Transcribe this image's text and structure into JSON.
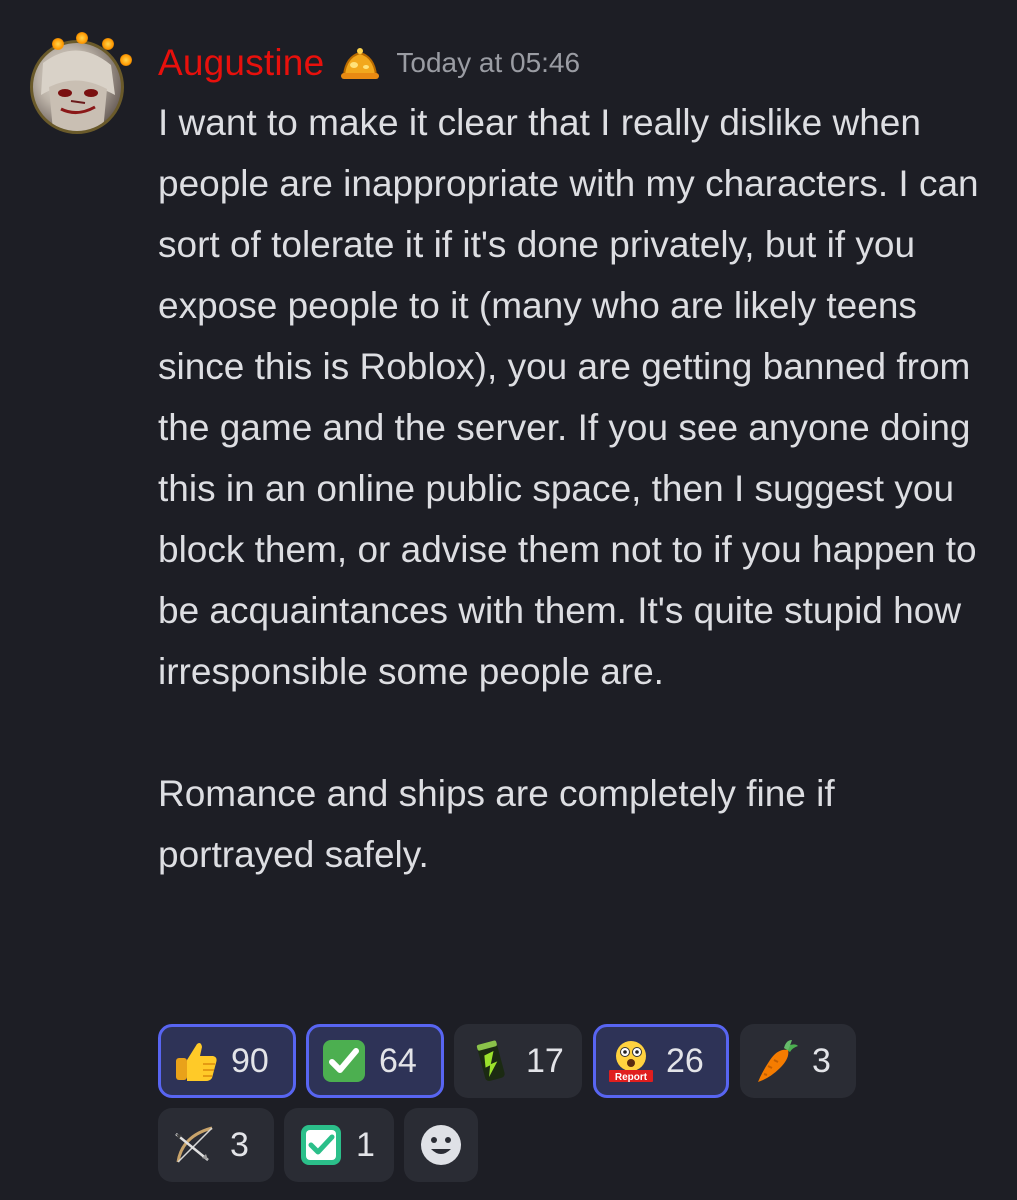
{
  "message": {
    "author": {
      "name": "Augustine",
      "name_color": "#e8100c"
    },
    "timestamp": "Today at 05:46",
    "paragraphs": [
      "I want to make it clear that I really dislike when people are inappropriate with my characters. I can sort of tolerate it if it's done privately, but if you expose people to it (many who are likely teens since this is Roblox), you are getting banned from the game and the server. If you see anyone doing this in an online public space, then I suggest you block them, or advise them not to if you happen to be acquaintances with them. It's quite stupid how irresponsible some people are.",
      "Romance and ships are completely fine if portrayed safely."
    ],
    "reactions": [
      {
        "emoji": "thumbs-up-icon",
        "count": "90",
        "active": true
      },
      {
        "emoji": "check-mark-button-icon",
        "count": "64",
        "active": true
      },
      {
        "emoji": "energy-drink-can-icon",
        "count": "17",
        "active": false
      },
      {
        "emoji": "report-shocked-face-icon",
        "label": "Report",
        "count": "26",
        "active": true
      },
      {
        "emoji": "carrot-icon",
        "count": "3",
        "active": false
      },
      {
        "emoji": "bow-and-arrow-icon",
        "count": "3",
        "active": false
      },
      {
        "emoji": "check-mark-green-icon",
        "count": "1",
        "active": false
      }
    ],
    "add_reaction": {
      "icon": "smiley-add-reaction-icon"
    }
  },
  "colors": {
    "background": "#1d1e25",
    "reaction_active_border": "#5865f2",
    "reaction_bg": "#2a2c34",
    "timestamp": "#9a9ca3"
  }
}
